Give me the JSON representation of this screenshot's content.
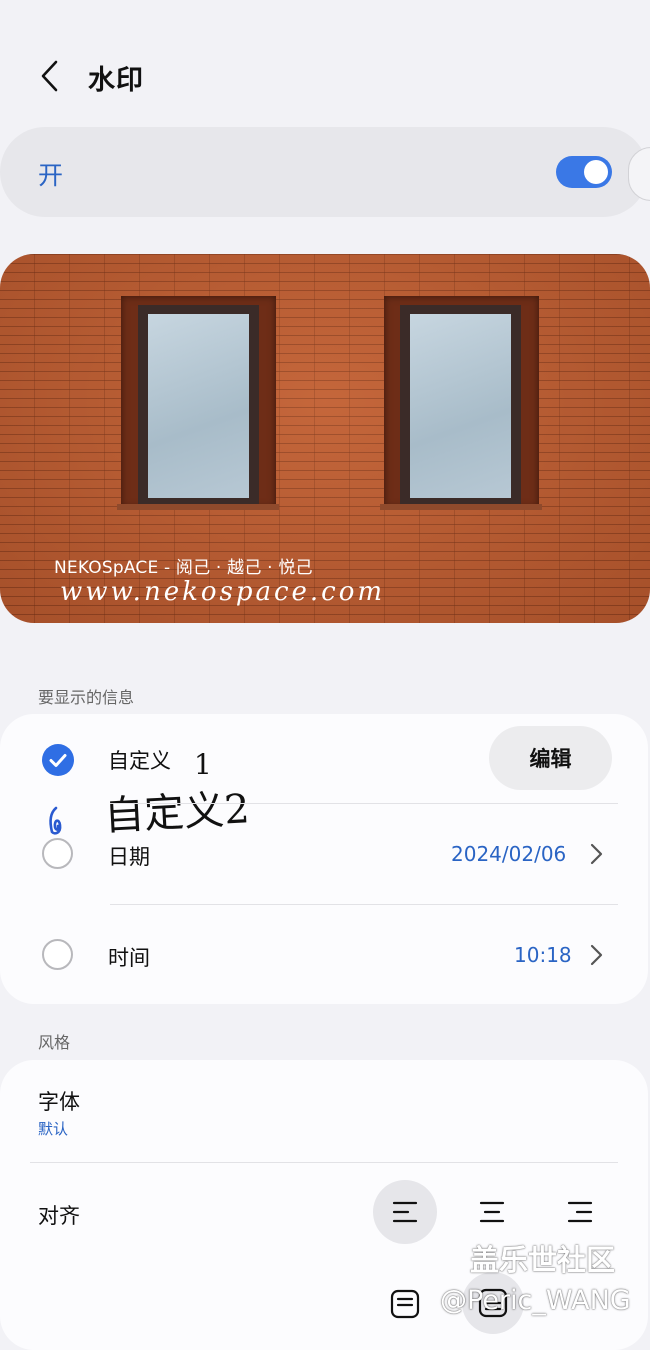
{
  "header": {
    "title": "水印"
  },
  "toggle": {
    "label": "开",
    "state": "on"
  },
  "preview": {
    "watermark_line1": "NEKOSpACE - 阅己 · 越己 · 悦己",
    "watermark_line2": "www.nekospace.com"
  },
  "info_section": {
    "title": "要显示的信息",
    "custom": {
      "label": "自定义",
      "handwritten_suffix": "1",
      "checked": true
    },
    "handwritten_note": "自定义2",
    "edit_button": "编辑",
    "date": {
      "label": "日期",
      "value": "2024/02/06",
      "checked": false
    },
    "time": {
      "label": "时间",
      "value": "10:18",
      "checked": false
    }
  },
  "style_section": {
    "title": "风格",
    "font": {
      "label": "字体",
      "value": "默认"
    },
    "align": {
      "label": "对齐",
      "selected": "left"
    }
  },
  "overlays": {
    "forum_watermark": "盖乐世社区",
    "author_watermark": "@Peric_WANG"
  },
  "colors": {
    "accent": "#2f6ee4",
    "link_blue": "#2a64c4",
    "background": "#f2f2f6",
    "card": "#fcfcfe"
  }
}
